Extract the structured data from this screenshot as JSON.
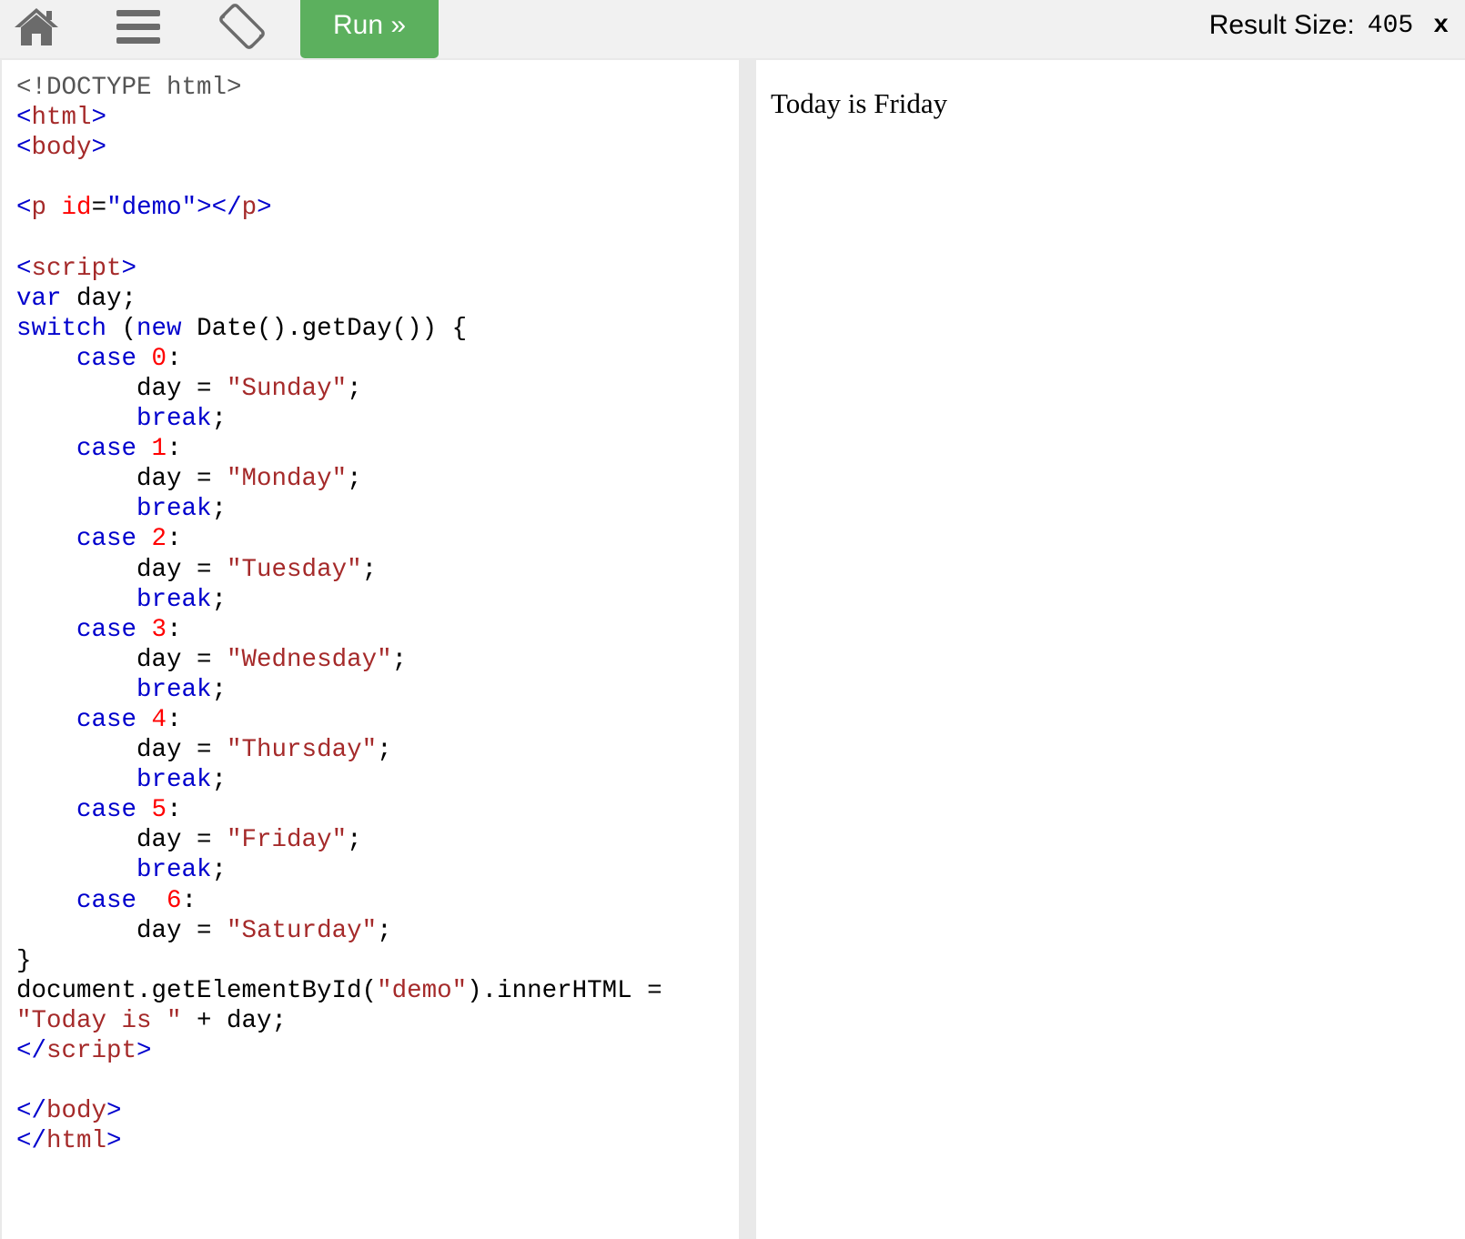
{
  "toolbar": {
    "home_icon": "home-icon",
    "menu_icon": "hamburger-menu-icon",
    "rotate_icon": "rotate-screen-icon",
    "run_label": "Run »",
    "run_color": "#5cb05e",
    "result_size_label": "Result Size:",
    "result_size_value": "405",
    "result_size_x": "x"
  },
  "editor": {
    "lines": [
      [
        [
          "doc",
          "<!DOCTYPE html>"
        ]
      ],
      [
        [
          "br",
          "<"
        ],
        [
          "tag",
          "html"
        ],
        [
          "br",
          ">"
        ]
      ],
      [
        [
          "br",
          "<"
        ],
        [
          "tag",
          "body"
        ],
        [
          "br",
          ">"
        ]
      ],
      [],
      [
        [
          "br",
          "<"
        ],
        [
          "tag",
          "p"
        ],
        [
          "txt",
          " "
        ],
        [
          "attr",
          "id"
        ],
        [
          "txt",
          "="
        ],
        [
          "val",
          "\"demo\""
        ],
        [
          "br",
          "></"
        ],
        [
          "tag",
          "p"
        ],
        [
          "br",
          ">"
        ]
      ],
      [],
      [
        [
          "br",
          "<"
        ],
        [
          "tag",
          "script"
        ],
        [
          "br",
          ">"
        ]
      ],
      [
        [
          "kw",
          "var"
        ],
        [
          "txt",
          " day;"
        ]
      ],
      [
        [
          "kw",
          "switch"
        ],
        [
          "txt",
          " ("
        ],
        [
          "kw",
          "new"
        ],
        [
          "txt",
          " Date().getDay()) {"
        ]
      ],
      [
        [
          "txt",
          "    "
        ],
        [
          "kw",
          "case"
        ],
        [
          "txt",
          " "
        ],
        [
          "num",
          "0"
        ],
        [
          "txt",
          ":"
        ]
      ],
      [
        [
          "txt",
          "        day = "
        ],
        [
          "str",
          "\"Sunday\""
        ],
        [
          "txt",
          ";"
        ]
      ],
      [
        [
          "txt",
          "        "
        ],
        [
          "kw",
          "break"
        ],
        [
          "txt",
          ";"
        ]
      ],
      [
        [
          "txt",
          "    "
        ],
        [
          "kw",
          "case"
        ],
        [
          "txt",
          " "
        ],
        [
          "num",
          "1"
        ],
        [
          "txt",
          ":"
        ]
      ],
      [
        [
          "txt",
          "        day = "
        ],
        [
          "str",
          "\"Monday\""
        ],
        [
          "txt",
          ";"
        ]
      ],
      [
        [
          "txt",
          "        "
        ],
        [
          "kw",
          "break"
        ],
        [
          "txt",
          ";"
        ]
      ],
      [
        [
          "txt",
          "    "
        ],
        [
          "kw",
          "case"
        ],
        [
          "txt",
          " "
        ],
        [
          "num",
          "2"
        ],
        [
          "txt",
          ":"
        ]
      ],
      [
        [
          "txt",
          "        day = "
        ],
        [
          "str",
          "\"Tuesday\""
        ],
        [
          "txt",
          ";"
        ]
      ],
      [
        [
          "txt",
          "        "
        ],
        [
          "kw",
          "break"
        ],
        [
          "txt",
          ";"
        ]
      ],
      [
        [
          "txt",
          "    "
        ],
        [
          "kw",
          "case"
        ],
        [
          "txt",
          " "
        ],
        [
          "num",
          "3"
        ],
        [
          "txt",
          ":"
        ]
      ],
      [
        [
          "txt",
          "        day = "
        ],
        [
          "str",
          "\"Wednesday\""
        ],
        [
          "txt",
          ";"
        ]
      ],
      [
        [
          "txt",
          "        "
        ],
        [
          "kw",
          "break"
        ],
        [
          "txt",
          ";"
        ]
      ],
      [
        [
          "txt",
          "    "
        ],
        [
          "kw",
          "case"
        ],
        [
          "txt",
          " "
        ],
        [
          "num",
          "4"
        ],
        [
          "txt",
          ":"
        ]
      ],
      [
        [
          "txt",
          "        day = "
        ],
        [
          "str",
          "\"Thursday\""
        ],
        [
          "txt",
          ";"
        ]
      ],
      [
        [
          "txt",
          "        "
        ],
        [
          "kw",
          "break"
        ],
        [
          "txt",
          ";"
        ]
      ],
      [
        [
          "txt",
          "    "
        ],
        [
          "kw",
          "case"
        ],
        [
          "txt",
          " "
        ],
        [
          "num",
          "5"
        ],
        [
          "txt",
          ":"
        ]
      ],
      [
        [
          "txt",
          "        day = "
        ],
        [
          "str",
          "\"Friday\""
        ],
        [
          "txt",
          ";"
        ]
      ],
      [
        [
          "txt",
          "        "
        ],
        [
          "kw",
          "break"
        ],
        [
          "txt",
          ";"
        ]
      ],
      [
        [
          "txt",
          "    "
        ],
        [
          "kw",
          "case"
        ],
        [
          "txt",
          "  "
        ],
        [
          "num",
          "6"
        ],
        [
          "txt",
          ":"
        ]
      ],
      [
        [
          "txt",
          "        day = "
        ],
        [
          "str",
          "\"Saturday\""
        ],
        [
          "txt",
          ";"
        ]
      ],
      [
        [
          "txt",
          "}"
        ]
      ],
      [
        [
          "txt",
          "document.getElementById("
        ],
        [
          "str",
          "\"demo\""
        ],
        [
          "txt",
          ").innerHTML ="
        ]
      ],
      [
        [
          "str",
          "\"Today is \""
        ],
        [
          "txt",
          " + day;"
        ]
      ],
      [
        [
          "br",
          "</"
        ],
        [
          "tag",
          "script"
        ],
        [
          "br",
          ">"
        ]
      ],
      [],
      [
        [
          "br",
          "</"
        ],
        [
          "tag",
          "body"
        ],
        [
          "br",
          ">"
        ]
      ],
      [
        [
          "br",
          "</"
        ],
        [
          "tag",
          "html"
        ],
        [
          "br",
          ">"
        ]
      ]
    ],
    "colors": {
      "tag": "#a52a2a",
      "bracket": "#0000cd",
      "attribute": "#ff0000",
      "keyword": "#0000cd",
      "string": "#a52a2a",
      "number": "#ff0000"
    }
  },
  "result": {
    "text": "Today is Friday"
  }
}
